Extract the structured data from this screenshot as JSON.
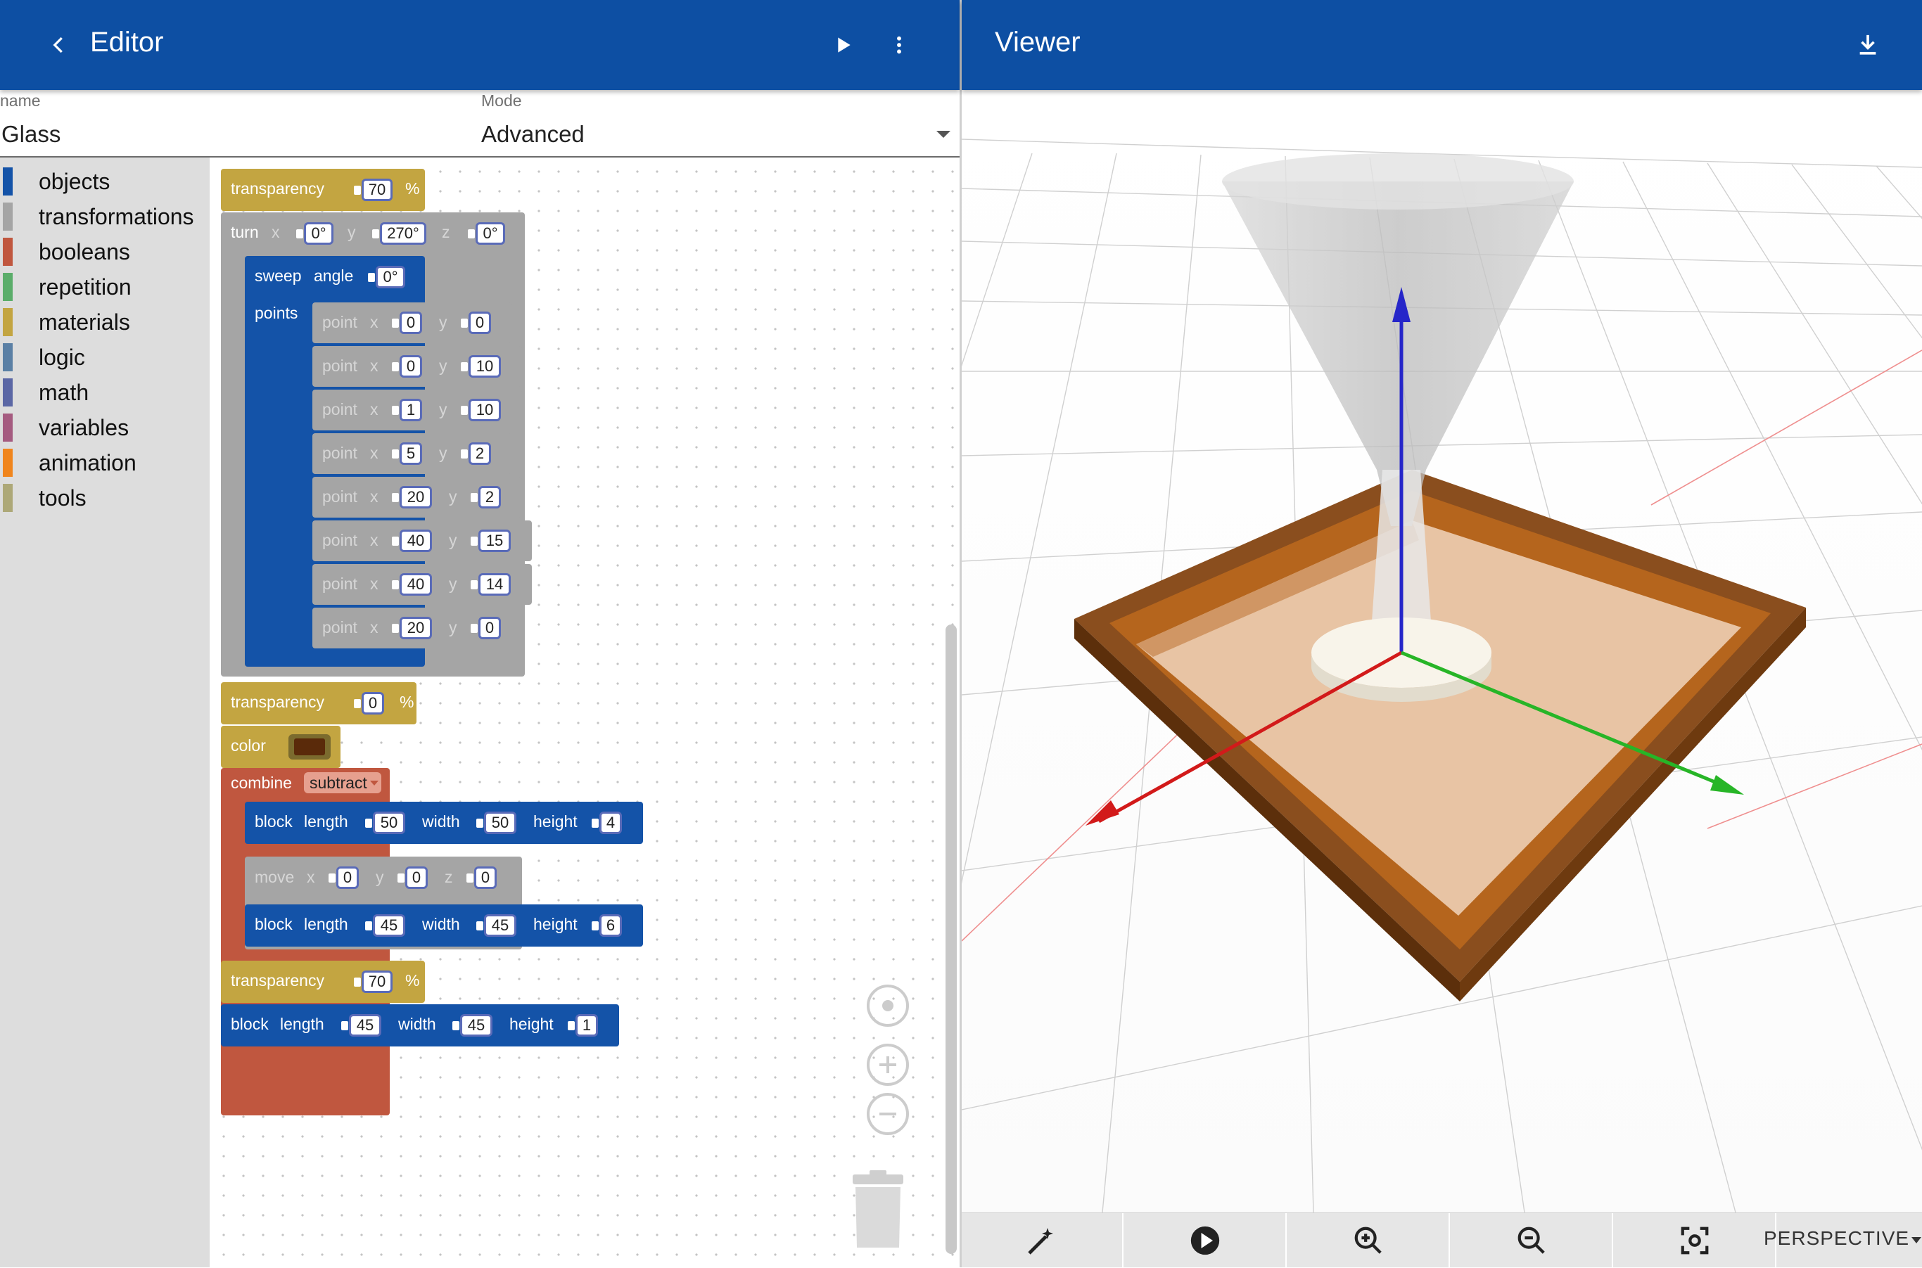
{
  "editor": {
    "title": "Editor",
    "back_icon": "chevron-left-icon",
    "run_icon": "play-icon",
    "menu_icon": "more-vert-icon"
  },
  "fields": {
    "name_label": "name",
    "name_value": "Glass",
    "mode_label": "Mode",
    "mode_value": "Advanced"
  },
  "toolbox": [
    {
      "label": "objects",
      "color": "#1453a8"
    },
    {
      "label": "transformations",
      "color": "#a5a5a5"
    },
    {
      "label": "booleans",
      "color": "#c0573f"
    },
    {
      "label": "repetition",
      "color": "#5bad6a"
    },
    {
      "label": "materials",
      "color": "#c3a541"
    },
    {
      "label": "logic",
      "color": "#5b80a5"
    },
    {
      "label": "math",
      "color": "#5b67a5"
    },
    {
      "label": "variables",
      "color": "#a55b80"
    },
    {
      "label": "animation",
      "color": "#f0851d"
    },
    {
      "label": "tools",
      "color": "#ada878"
    }
  ],
  "blocks": {
    "transparency1": {
      "label": "transparency",
      "value": "70",
      "unit": "%"
    },
    "turn": {
      "label": "turn",
      "x_label": "x",
      "x": "0°",
      "y_label": "y",
      "y": "270°",
      "z_label": "z",
      "z": "0°"
    },
    "sweep": {
      "label": "sweep",
      "angle_label": "angle",
      "angle": "0°",
      "points_label": "points"
    },
    "points": [
      {
        "label": "point",
        "x_label": "x",
        "x": "0",
        "y_label": "y",
        "y": "0"
      },
      {
        "label": "point",
        "x_label": "x",
        "x": "0",
        "y_label": "y",
        "y": "10"
      },
      {
        "label": "point",
        "x_label": "x",
        "x": "1",
        "y_label": "y",
        "y": "10"
      },
      {
        "label": "point",
        "x_label": "x",
        "x": "5",
        "y_label": "y",
        "y": "2"
      },
      {
        "label": "point",
        "x_label": "x",
        "x": "20",
        "y_label": "y",
        "y": "2"
      },
      {
        "label": "point",
        "x_label": "x",
        "x": "40",
        "y_label": "y",
        "y": "15"
      },
      {
        "label": "point",
        "x_label": "x",
        "x": "40",
        "y_label": "y",
        "y": "14"
      },
      {
        "label": "point",
        "x_label": "x",
        "x": "20",
        "y_label": "y",
        "y": "0"
      }
    ],
    "transparency2": {
      "label": "transparency",
      "value": "0",
      "unit": "%"
    },
    "color": {
      "label": "color",
      "swatch": "#5a2a0a"
    },
    "combine": {
      "label": "combine",
      "op": "subtract"
    },
    "block1": {
      "label": "block",
      "length_label": "length",
      "length": "50",
      "width_label": "width",
      "width": "50",
      "height_label": "height",
      "height": "4"
    },
    "move": {
      "label": "move",
      "x_label": "x",
      "x": "0",
      "y_label": "y",
      "y": "0",
      "z_label": "z",
      "z": "0"
    },
    "block2": {
      "label": "block",
      "length_label": "length",
      "length": "45",
      "width_label": "width",
      "width": "45",
      "height_label": "height",
      "height": "6"
    },
    "transparency3": {
      "label": "transparency",
      "value": "70",
      "unit": "%"
    },
    "block3": {
      "label": "block",
      "length_label": "length",
      "length": "45",
      "width_label": "width",
      "width": "45",
      "height_label": "height",
      "height": "1"
    }
  },
  "workspace_controls": {
    "recenter_icon": "target-icon",
    "zoom_in_icon": "plus-circle-icon",
    "zoom_out_icon": "minus-circle-icon",
    "trash_icon": "trash-icon"
  },
  "viewer": {
    "title": "Viewer",
    "download_icon": "download-icon"
  },
  "viewer_toolbar": {
    "tools": [
      "magic-wand-icon",
      "play-circle-icon",
      "zoom-in-icon",
      "zoom-out-icon",
      "focus-icon"
    ],
    "projection": "PERSPECTIVE"
  },
  "colors": {
    "appbar": "#0d4fa3",
    "objects": "#1453a8",
    "transformations": "#a5a5a5",
    "booleans": "#c0573f",
    "materials": "#c3a541"
  }
}
